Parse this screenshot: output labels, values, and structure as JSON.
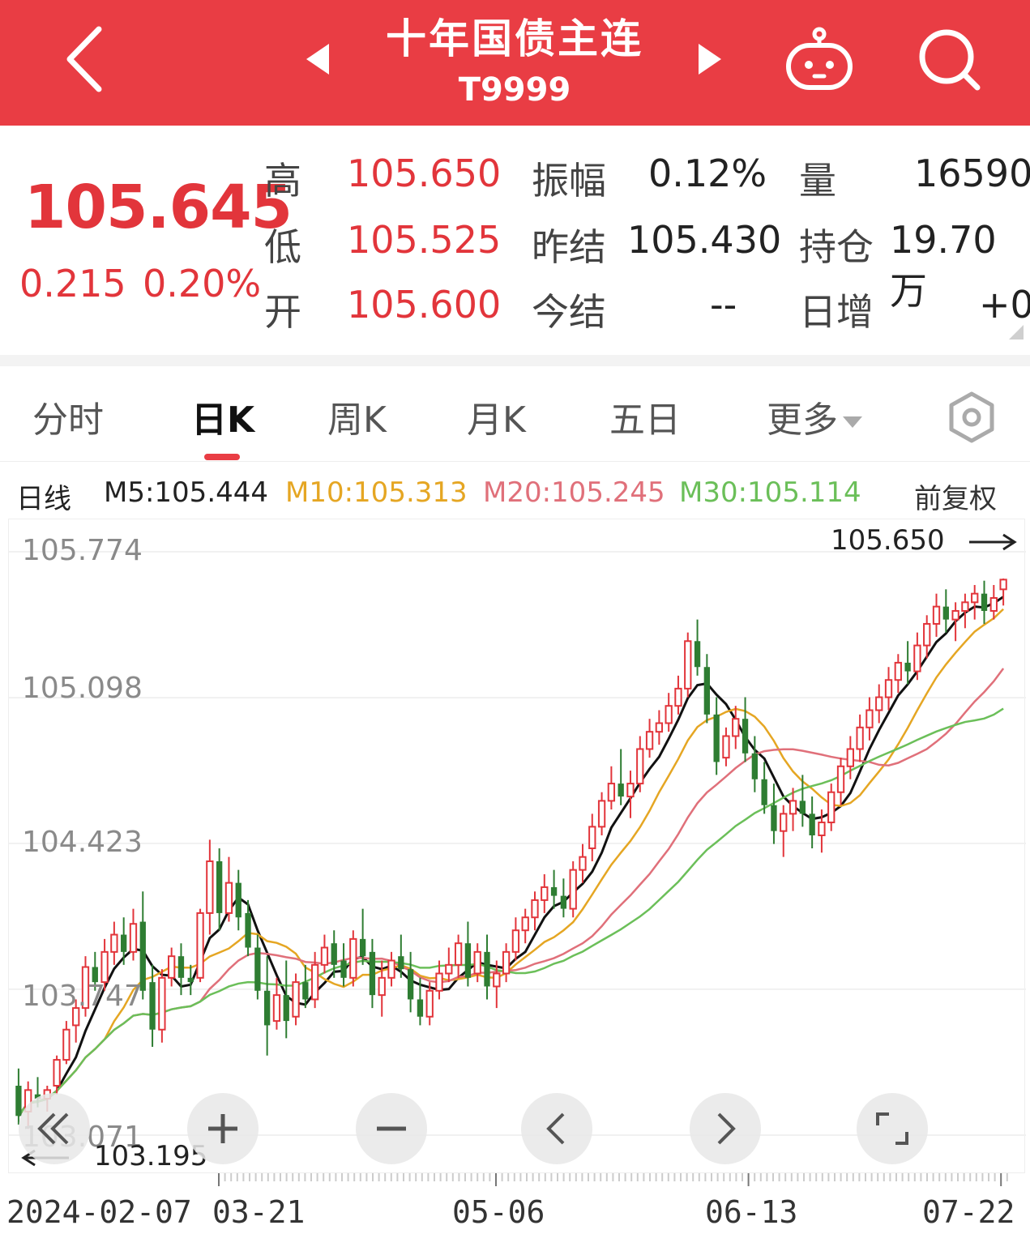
{
  "header": {
    "title": "十年国债主连",
    "code": "T9999"
  },
  "quote": {
    "price": "105.645",
    "change": "0.215",
    "change_pct": "0.20%",
    "high_label": "高",
    "high": "105.650",
    "low_label": "低",
    "low": "105.525",
    "open_label": "开",
    "open": "105.600",
    "amplitude_label": "振幅",
    "amplitude": "0.12%",
    "prev_settle_label": "昨结",
    "prev_settle": "105.430",
    "settle_label": "今结",
    "settle": "--",
    "volume_label": "量",
    "volume": "16590",
    "open_interest_label": "持仓",
    "open_interest": "19.70万",
    "daily_change_label": "日增",
    "daily_change": "+0"
  },
  "tabs": [
    {
      "label": "分时"
    },
    {
      "label": "日K"
    },
    {
      "label": "周K"
    },
    {
      "label": "月K"
    },
    {
      "label": "五日"
    },
    {
      "label": "更多"
    }
  ],
  "ma_legend": {
    "line_type": "日线",
    "m5": "M5:105.444",
    "m10": "M10:105.313",
    "m20": "M20:105.245",
    "m30": "M30:105.114",
    "adjust": "前复权"
  },
  "colors": {
    "brand": "#e93d44",
    "up": "#e2353b",
    "down": "#2e7d32",
    "m5": "#111111",
    "m10": "#e5a623",
    "m20": "#e0707a",
    "m30": "#6bbf59"
  },
  "icons": {
    "back": "chevron-left-icon",
    "prev": "triangle-left-icon",
    "next": "triangle-right-icon",
    "robot": "robot-icon",
    "search": "search-icon",
    "settings": "hexagon-settings-icon",
    "controls": [
      "double-chevron-left-icon",
      "plus-icon",
      "minus-icon",
      "chevron-left-icon",
      "chevron-right-icon",
      "fullscreen-icon"
    ]
  },
  "chart_data": {
    "type": "candlestick",
    "y_ticks": [
      "105.774",
      "105.098",
      "104.423",
      "103.747",
      "103.071"
    ],
    "y_tick_values": [
      105.774,
      105.098,
      104.423,
      103.747,
      103.071
    ],
    "ylim": [
      103.071,
      105.774
    ],
    "x_labels": [
      "2024-02-07",
      "03-21",
      "05-06",
      "06-13",
      "07-22"
    ],
    "max_label": "105.650",
    "min_label": "103.195",
    "ohlc": [
      [
        103.3,
        103.38,
        103.12,
        103.16
      ],
      [
        103.18,
        103.32,
        103.1,
        103.28
      ],
      [
        103.26,
        103.34,
        103.2,
        103.24
      ],
      [
        103.24,
        103.3,
        103.18,
        103.28
      ],
      [
        103.3,
        103.44,
        103.26,
        103.42
      ],
      [
        103.42,
        103.6,
        103.4,
        103.56
      ],
      [
        103.58,
        103.7,
        103.5,
        103.66
      ],
      [
        103.66,
        103.9,
        103.62,
        103.85
      ],
      [
        103.85,
        103.92,
        103.74,
        103.78
      ],
      [
        103.78,
        103.98,
        103.74,
        103.92
      ],
      [
        103.92,
        104.06,
        103.86,
        104.0
      ],
      [
        104.0,
        104.08,
        103.86,
        103.92
      ],
      [
        103.92,
        104.12,
        103.88,
        104.05
      ],
      [
        104.06,
        104.2,
        103.7,
        103.74
      ],
      [
        103.78,
        103.86,
        103.48,
        103.56
      ],
      [
        103.56,
        103.84,
        103.5,
        103.8
      ],
      [
        103.8,
        103.94,
        103.76,
        103.9
      ],
      [
        103.9,
        103.96,
        103.72,
        103.8
      ],
      [
        103.8,
        103.86,
        103.72,
        103.78
      ],
      [
        103.8,
        104.12,
        103.78,
        104.1
      ],
      [
        104.1,
        104.44,
        104.0,
        104.34
      ],
      [
        104.34,
        104.4,
        104.02,
        104.1
      ],
      [
        104.1,
        104.36,
        104.06,
        104.24
      ],
      [
        104.24,
        104.3,
        104.02,
        104.08
      ],
      [
        104.1,
        104.16,
        103.9,
        103.94
      ],
      [
        103.94,
        104.0,
        103.7,
        103.74
      ],
      [
        103.74,
        103.9,
        103.44,
        103.58
      ],
      [
        103.6,
        103.8,
        103.56,
        103.72
      ],
      [
        103.72,
        103.88,
        103.52,
        103.6
      ],
      [
        103.62,
        103.82,
        103.58,
        103.78
      ],
      [
        103.78,
        103.86,
        103.66,
        103.7
      ],
      [
        103.7,
        103.92,
        103.66,
        103.86
      ],
      [
        103.86,
        104.0,
        103.82,
        103.94
      ],
      [
        103.96,
        104.02,
        103.8,
        103.86
      ],
      [
        103.88,
        103.96,
        103.76,
        103.8
      ],
      [
        103.8,
        104.02,
        103.76,
        103.98
      ],
      [
        103.98,
        104.12,
        103.86,
        103.9
      ],
      [
        103.92,
        103.98,
        103.66,
        103.72
      ],
      [
        103.72,
        103.88,
        103.62,
        103.8
      ],
      [
        103.8,
        103.92,
        103.76,
        103.88
      ],
      [
        103.9,
        104.0,
        103.8,
        103.84
      ],
      [
        103.84,
        103.92,
        103.64,
        103.7
      ],
      [
        103.7,
        103.8,
        103.58,
        103.62
      ],
      [
        103.62,
        103.78,
        103.58,
        103.74
      ],
      [
        103.74,
        103.88,
        103.7,
        103.82
      ],
      [
        103.82,
        103.94,
        103.78,
        103.86
      ],
      [
        103.86,
        104.0,
        103.8,
        103.96
      ],
      [
        103.96,
        104.06,
        103.76,
        103.8
      ],
      [
        103.82,
        103.96,
        103.78,
        103.92
      ],
      [
        103.92,
        104.0,
        103.7,
        103.76
      ],
      [
        103.76,
        103.88,
        103.66,
        103.82
      ],
      [
        103.82,
        103.96,
        103.78,
        103.92
      ],
      [
        103.92,
        104.08,
        103.88,
        104.02
      ],
      [
        104.02,
        104.12,
        103.96,
        104.08
      ],
      [
        104.08,
        104.2,
        104.02,
        104.16
      ],
      [
        104.16,
        104.28,
        104.1,
        104.22
      ],
      [
        104.22,
        104.3,
        104.12,
        104.18
      ],
      [
        104.18,
        104.26,
        104.08,
        104.12
      ],
      [
        104.12,
        104.34,
        104.08,
        104.3
      ],
      [
        104.3,
        104.42,
        104.24,
        104.36
      ],
      [
        104.4,
        104.56,
        104.34,
        104.5
      ],
      [
        104.5,
        104.66,
        104.46,
        104.62
      ],
      [
        104.62,
        104.78,
        104.58,
        104.7
      ],
      [
        104.7,
        104.86,
        104.6,
        104.64
      ],
      [
        104.64,
        104.76,
        104.54,
        104.7
      ],
      [
        104.7,
        104.92,
        104.66,
        104.86
      ],
      [
        104.86,
        105.0,
        104.82,
        104.94
      ],
      [
        104.94,
        105.04,
        104.88,
        104.98
      ],
      [
        104.98,
        105.12,
        104.94,
        105.06
      ],
      [
        105.06,
        105.2,
        105.02,
        105.14
      ],
      [
        105.14,
        105.4,
        105.1,
        105.36
      ],
      [
        105.36,
        105.46,
        105.2,
        105.24
      ],
      [
        105.24,
        105.3,
        104.98,
        105.02
      ],
      [
        105.02,
        105.1,
        104.74,
        104.8
      ],
      [
        104.82,
        104.96,
        104.78,
        104.92
      ],
      [
        104.92,
        105.06,
        104.86,
        105.0
      ],
      [
        105.0,
        105.1,
        104.8,
        104.84
      ],
      [
        104.84,
        104.92,
        104.66,
        104.72
      ],
      [
        104.72,
        104.8,
        104.56,
        104.6
      ],
      [
        104.6,
        104.7,
        104.42,
        104.48
      ],
      [
        104.48,
        104.6,
        104.36,
        104.56
      ],
      [
        104.56,
        104.68,
        104.48,
        104.62
      ],
      [
        104.62,
        104.74,
        104.5,
        104.56
      ],
      [
        104.56,
        104.64,
        104.4,
        104.46
      ],
      [
        104.46,
        104.58,
        104.38,
        104.52
      ],
      [
        104.52,
        104.7,
        104.48,
        104.66
      ],
      [
        104.66,
        104.82,
        104.6,
        104.78
      ],
      [
        104.78,
        104.92,
        104.72,
        104.86
      ],
      [
        104.86,
        105.02,
        104.8,
        104.96
      ],
      [
        104.96,
        105.1,
        104.9,
        105.04
      ],
      [
        105.04,
        105.16,
        104.98,
        105.1
      ],
      [
        105.1,
        105.24,
        105.04,
        105.18
      ],
      [
        105.18,
        105.3,
        105.12,
        105.26
      ],
      [
        105.26,
        105.36,
        105.16,
        105.22
      ],
      [
        105.22,
        105.4,
        105.18,
        105.34
      ],
      [
        105.34,
        105.48,
        105.28,
        105.44
      ],
      [
        105.44,
        105.58,
        105.38,
        105.52
      ],
      [
        105.52,
        105.6,
        105.4,
        105.46
      ],
      [
        105.46,
        105.54,
        105.36,
        105.5
      ],
      [
        105.5,
        105.58,
        105.42,
        105.54
      ],
      [
        105.54,
        105.62,
        105.46,
        105.58
      ],
      [
        105.58,
        105.64,
        105.44,
        105.5
      ],
      [
        105.5,
        105.62,
        105.46,
        105.56
      ],
      [
        105.6,
        105.65,
        105.525,
        105.645
      ]
    ]
  }
}
